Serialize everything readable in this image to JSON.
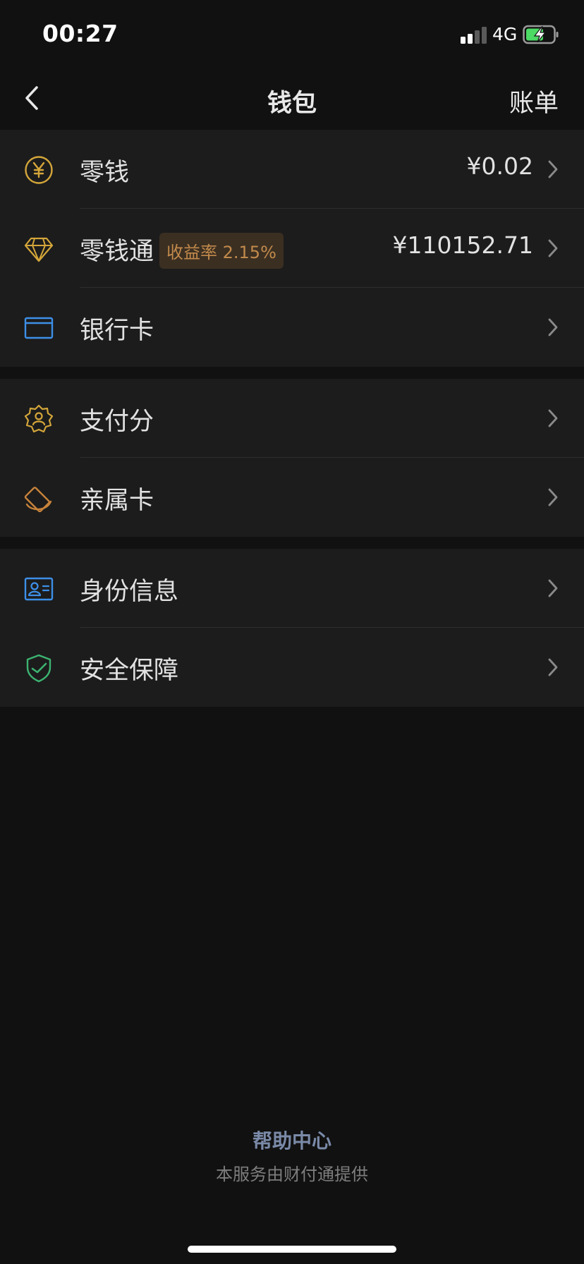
{
  "status": {
    "time": "00:27",
    "network": "4G"
  },
  "nav": {
    "title": "钱包",
    "right_label": "账单"
  },
  "groups": [
    {
      "rows": [
        {
          "label": "零钱",
          "value": "¥0.02",
          "icon": "yuan-coin-icon",
          "color": "#d4a63a"
        },
        {
          "label": "零钱通",
          "badge": "收益率 2.15%",
          "value": "¥110152.71",
          "icon": "diamond-icon",
          "color": "#d4a63a"
        },
        {
          "label": "银行卡",
          "icon": "bank-card-icon",
          "color": "#3d8fe8"
        }
      ]
    },
    {
      "rows": [
        {
          "label": "支付分",
          "icon": "pay-score-badge-icon",
          "color": "#d4a63a"
        },
        {
          "label": "亲属卡",
          "icon": "family-card-icon",
          "color": "#c8833a"
        }
      ]
    },
    {
      "rows": [
        {
          "label": "身份信息",
          "icon": "id-card-icon",
          "color": "#3d8fe8"
        },
        {
          "label": "安全保障",
          "icon": "shield-check-icon",
          "color": "#3cb371"
        }
      ]
    }
  ],
  "footer": {
    "help_link": "帮助中心",
    "note": "本服务由财付通提供"
  },
  "colors": {
    "background": "#111111",
    "row_background": "#1c1c1c",
    "badge_background": "#3b2f22",
    "badge_text": "#c28a4b"
  }
}
